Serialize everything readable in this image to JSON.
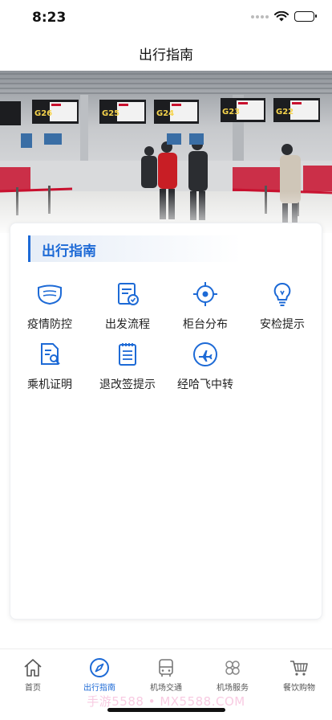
{
  "status_bar": {
    "time": "8:23"
  },
  "header": {
    "title": "出行指南"
  },
  "banner": {
    "image": "airport-check-in-counters-photo",
    "gate_signs": [
      "G26",
      "G25",
      "G24",
      "G23",
      "G22"
    ]
  },
  "section": {
    "title": "出行指南",
    "accent_color": "#1d6ad6"
  },
  "grid": [
    {
      "icon": "face-mask-icon",
      "label": "疫情防控"
    },
    {
      "icon": "departure-process-icon",
      "label": "出发流程"
    },
    {
      "icon": "location-target-icon",
      "label": "柜台分布"
    },
    {
      "icon": "lightbulb-icon",
      "label": "安检提示"
    },
    {
      "icon": "document-certificate-icon",
      "label": "乘机证明"
    },
    {
      "icon": "notepad-icon",
      "label": "退改签提示"
    },
    {
      "icon": "airplane-icon",
      "label": "经哈飞中转"
    }
  ],
  "tabs": [
    {
      "icon": "home-icon",
      "label": "首页",
      "active": false
    },
    {
      "icon": "compass-icon",
      "label": "出行指南",
      "active": true
    },
    {
      "icon": "bus-icon",
      "label": "机场交通",
      "active": false
    },
    {
      "icon": "services-icon",
      "label": "机场服务",
      "active": false
    },
    {
      "icon": "shopping-cart-icon",
      "label": "餐饮购物",
      "active": false
    }
  ],
  "watermark": {
    "text": "手游5588 • MX5588.COM"
  },
  "colors": {
    "accent": "#1d6ad6",
    "tab_inactive": "#555555",
    "sign_red": "#c8102e"
  }
}
